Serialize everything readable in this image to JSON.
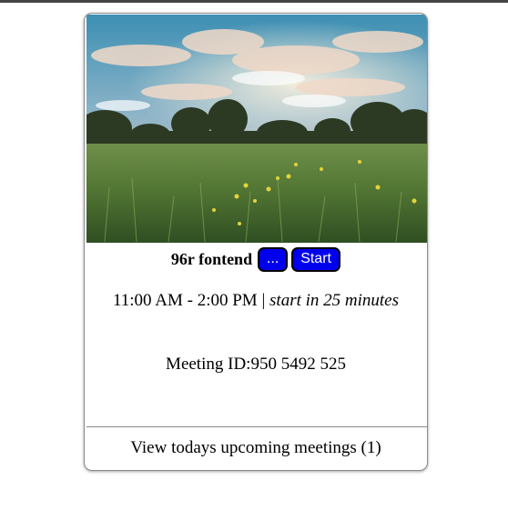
{
  "card": {
    "title": "96r fontend",
    "more_button_label": "...",
    "start_button_label": "Start",
    "time_range": "11:00 AM - 2:00 PM",
    "separator": "|",
    "start_hint": "start in 25 minutes",
    "meeting_id_label": "Meeting ID:",
    "meeting_id": "950 5492 525",
    "footer_link": "View todays upcoming meetings (1)"
  },
  "colors": {
    "button_bg": "#0000ee",
    "button_text": "#ffffff",
    "card_border": "#8a8a8a"
  },
  "image": {
    "subject": "meadow-with-wildflowers-under-cloudy-sky"
  }
}
